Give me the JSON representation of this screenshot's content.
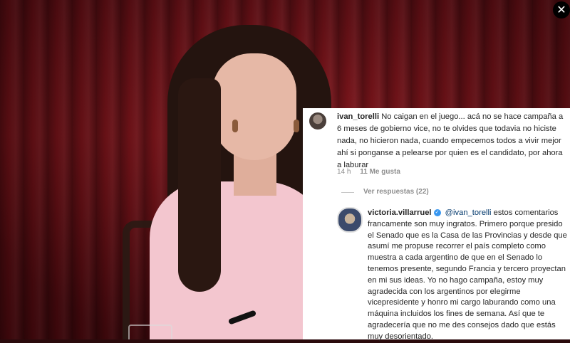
{
  "overlay": {
    "close_icon": "close-icon"
  },
  "comment1": {
    "username": "ivan_torelli",
    "text": "No caigan en el juego... acá no se hace campaña a 6 meses de gobierno vice, no te olvides que todavia no hiciste nada, no hicieron nada, cuando empecemos todos a vivir mejor ahí si ponganse a pelearse por quien es el candidato, por ahora a laburar",
    "time": "14 h",
    "likes": "11 Me gusta",
    "view_replies": "Ver respuestas (22)"
  },
  "comment2": {
    "username": "victoria.villarruel",
    "mention": "@ivan_torelli",
    "text": "estos comentarios francamente son muy ingratos. Primero porque presido el Senado que es la Casa de las Provincias y desde que asumí me propuse recorrer el país completo como muestra a cada argentino de que en el Senado lo tenemos presente, segundo Francia y tercero proyectan en mi sus ideas. Yo no hago campaña, estoy muy agradecida con los argentinos por elegirme vicepresidente y honro mi cargo laburando como una máquina incluidos los fines de semana. Así que te agradecería que no me des consejos dado que estás muy desorientado."
  },
  "colors": {
    "verified": "#3897f0",
    "mention": "#00376b",
    "text": "#262626",
    "muted": "#8e8e8e"
  }
}
